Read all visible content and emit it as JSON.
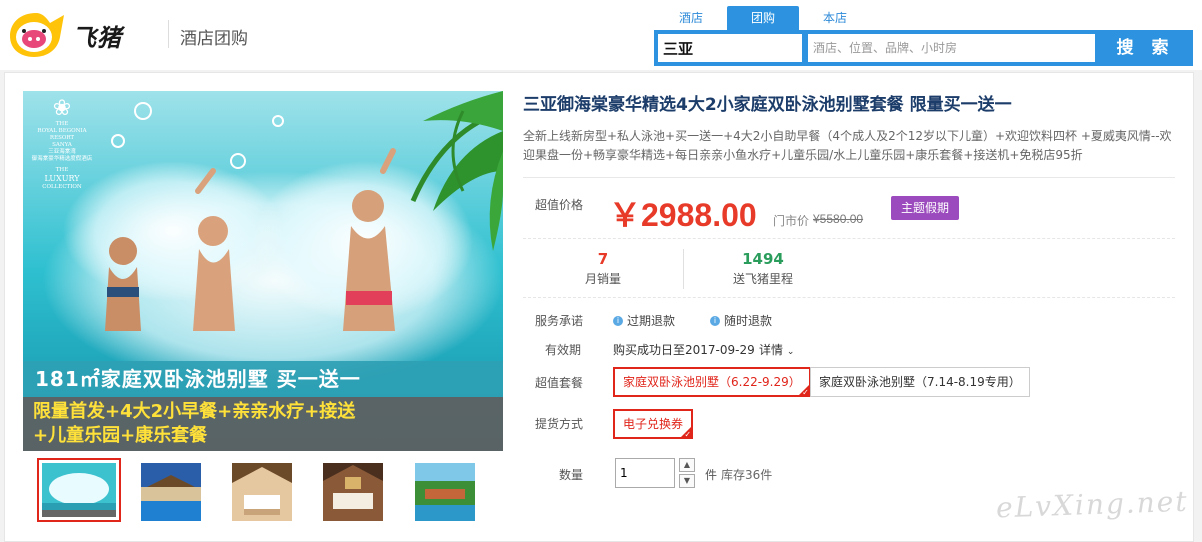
{
  "header": {
    "brand": "飞猪",
    "subtitle": "酒店团购"
  },
  "search": {
    "tabs": [
      {
        "label": "酒店",
        "active": false
      },
      {
        "label": "团购",
        "active": true
      },
      {
        "label": "本店",
        "active": false
      }
    ],
    "city_value": "三亚",
    "keyword_placeholder": "酒店、位置、品牌、小时房",
    "button_label": "搜 索"
  },
  "gallery": {
    "resort_name": [
      "THE",
      "ROYAL BEGONIA",
      "RESORT",
      "SANYA",
      "三亚海棠湾",
      "御海棠豪华精选度假酒店"
    ],
    "collection": [
      "THE",
      "LUXURY",
      "COLLECTION"
    ],
    "banner_line1": "181㎡家庭双卧泳池别墅  买一送一",
    "banner_line2": "限量首发+4大2小早餐+亲亲水疗+接送",
    "banner_line3": "+儿童乐园+康乐套餐",
    "thumbnails": 5
  },
  "product": {
    "title": "三亚御海棠豪华精选4大2小家庭双卧泳池别墅套餐 限量买一送一",
    "description": "全新上线新房型+私人泳池+买一送一+4大2小自助早餐（4个成人及2个12岁以下儿童）+欢迎饮料四杯 +夏威夷风情--欢迎果盘一份+畅享豪华精选+每日亲亲小鱼水疗+儿童乐园/水上儿童乐园+康乐套餐+接送机+免税店95折",
    "price_label": "超值价格",
    "price": "￥2988.00",
    "retail_label": "门市价",
    "retail_price": "¥5580.00",
    "theme_badge": "主题假期",
    "monthly_sales_value": "7",
    "monthly_sales_label": "月销量",
    "points_value": "1494",
    "points_label": "送飞猪里程",
    "promise_label": "服务承诺",
    "promises": [
      "过期退款",
      "随时退款"
    ],
    "validity_label": "有效期",
    "validity_value": "购买成功日至2017-09-29",
    "details_link": "详情",
    "package_label": "超值套餐",
    "packages": [
      "家庭双卧泳池别墅（6.22-9.29）",
      "家庭双卧泳池别墅（7.14-8.19专用）"
    ],
    "delivery_label": "提货方式",
    "delivery_option": "电子兑换券",
    "qty_label": "数量",
    "qty_value": "1",
    "qty_unit": "件",
    "stock": "库存36件"
  },
  "colors": {
    "accent_blue": "#2d93e0",
    "price_red": "#e83a28",
    "badge_purple": "#9b4bbd",
    "points_green": "#2a9d5c"
  },
  "watermark": "eLvXing.net"
}
